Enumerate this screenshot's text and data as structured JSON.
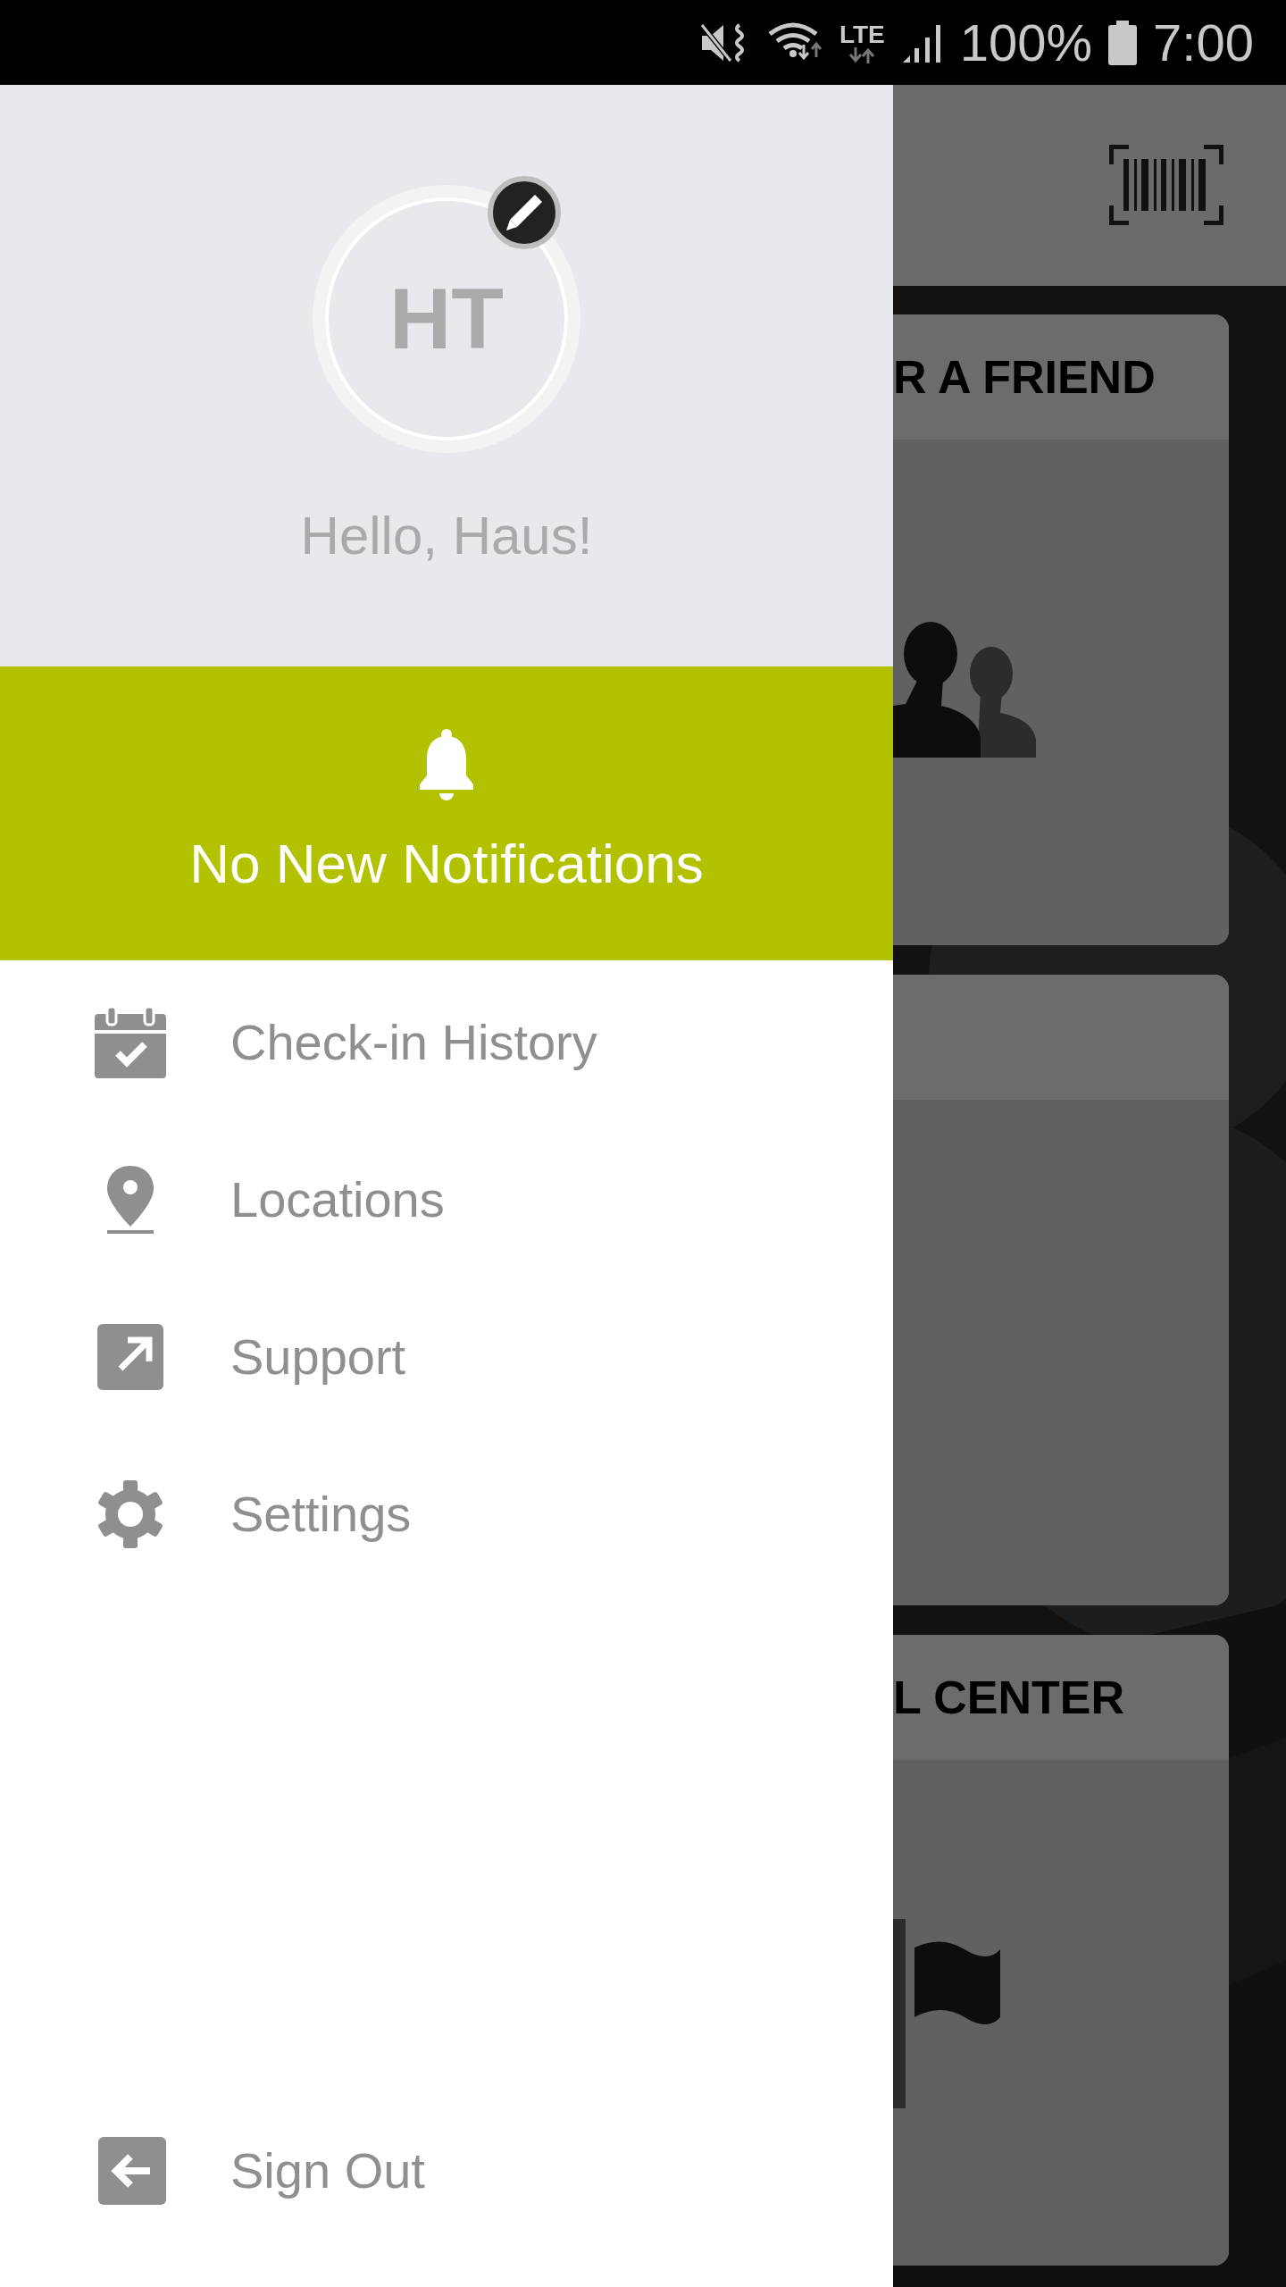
{
  "status_bar": {
    "network": "LTE",
    "battery": "100%",
    "time": "7:00"
  },
  "drawer": {
    "avatar_initials": "HT",
    "greeting": "Hello, Haus!",
    "notifications": "No New Notifications",
    "menu": [
      {
        "label": "Check-in History",
        "kind": "calendar"
      },
      {
        "label": "Locations",
        "kind": "pin"
      },
      {
        "label": "Support",
        "kind": "external"
      },
      {
        "label": "Settings",
        "kind": "gear"
      }
    ],
    "sign_out": "Sign Out"
  },
  "background_cards": [
    {
      "title": "R A FRIEND",
      "kind": "people"
    },
    {
      "kind": "blank"
    },
    {
      "title": "L CENTER",
      "kind": "flag"
    }
  ]
}
